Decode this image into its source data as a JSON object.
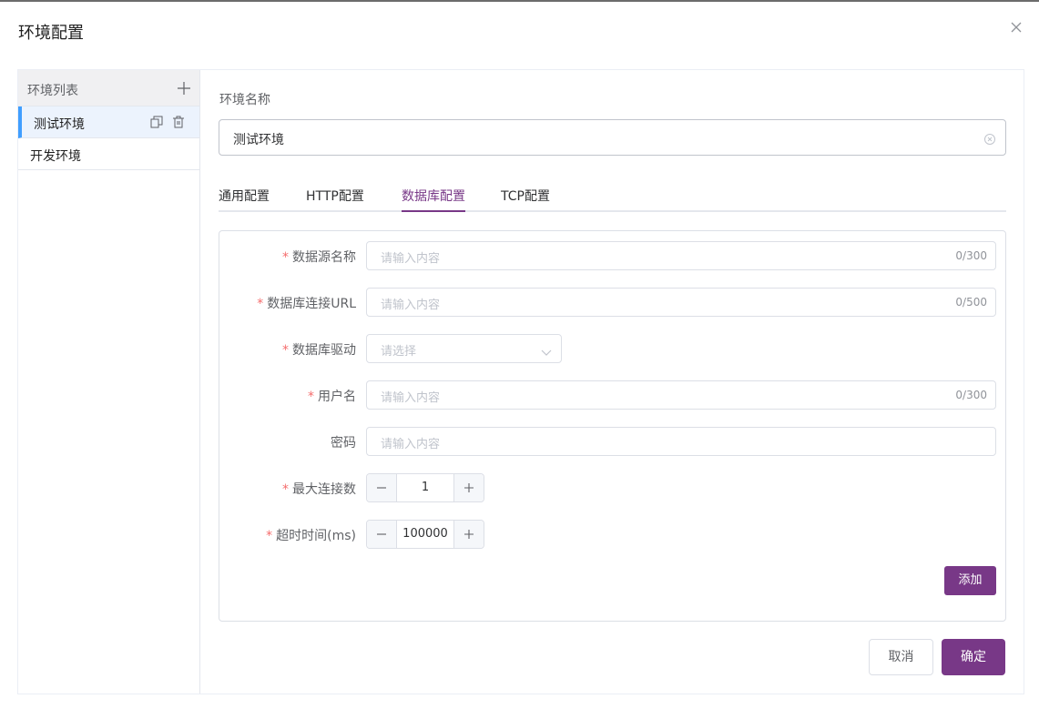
{
  "dialog": {
    "title": "环境配置"
  },
  "sidebar": {
    "title": "环境列表",
    "items": [
      {
        "label": "测试环境",
        "active": true
      },
      {
        "label": "开发环境",
        "active": false
      }
    ]
  },
  "env_name": {
    "label": "环境名称",
    "value": "测试环境"
  },
  "tabs": [
    {
      "label": "通用配置"
    },
    {
      "label": "HTTP配置"
    },
    {
      "label": "数据库配置",
      "active": true
    },
    {
      "label": "TCP配置"
    }
  ],
  "form": {
    "datasource_name": {
      "label": "数据源名称",
      "placeholder": "请输入内容",
      "count": "0/300",
      "required": true
    },
    "db_url": {
      "label": "数据库连接URL",
      "placeholder": "请输入内容",
      "count": "0/500",
      "required": true
    },
    "db_driver": {
      "label": "数据库驱动",
      "placeholder": "请选择",
      "required": true
    },
    "username": {
      "label": "用户名",
      "placeholder": "请输入内容",
      "count": "0/300",
      "required": true
    },
    "password": {
      "label": "密码",
      "placeholder": "请输入内容",
      "required": false
    },
    "max_connections": {
      "label": "最大连接数",
      "value": "1",
      "required": true
    },
    "timeout": {
      "label": "超时时间(ms)",
      "value": "100000",
      "required": true
    },
    "add_label": "添加"
  },
  "footer": {
    "cancel_label": "取消",
    "confirm_label": "确定"
  },
  "colors": {
    "accent": "#783887",
    "active_indicator": "#409eff",
    "required": "#f56c6c"
  }
}
